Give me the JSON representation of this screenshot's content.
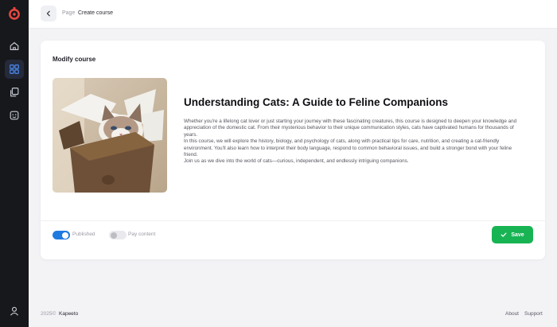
{
  "topbar": {
    "breadcrumb_label": "Page",
    "breadcrumb_value": "Create course"
  },
  "card": {
    "title": "Modify course",
    "course_title": "Understanding Cats: A Guide to Feline Companions",
    "description": [
      "Whether you're a lifelong cat lover or just starting your journey with these fascinating creatures, this course is designed to deepen your knowledge and appreciation of the domestic cat. From their mysterious behavior to their unique communication styles, cats have captivated humans for thousands of years.",
      "In this course, we will explore the history, biology, and psychology of cats, along with practical tips for care, nutrition, and creating a cat-friendly environment. You'll also learn how to interpret their body language, respond to common behavioral issues, and build a stronger bond with your feline friend.",
      "Join us as we dive into the world of cats—curious, independent, and endlessly intriguing companions."
    ],
    "toggles": {
      "published_label": "Published",
      "published_on": true,
      "pay_label": "Pay content",
      "pay_on": false
    },
    "save_label": "Save"
  },
  "footer": {
    "copyright": "2025©",
    "brand": "Kapeeto",
    "about": "About",
    "support": "Support"
  },
  "colors": {
    "sidebar_bg": "#16181c",
    "logo": "#e8473f",
    "accent_blue": "#1f7ae0",
    "save_green": "#18b454"
  },
  "icons": {
    "sidebar": [
      "home-icon",
      "grid-icon",
      "copy-icon",
      "face-icon",
      "user-icon"
    ],
    "back": "chevron-left-icon",
    "save": "check-icon"
  }
}
